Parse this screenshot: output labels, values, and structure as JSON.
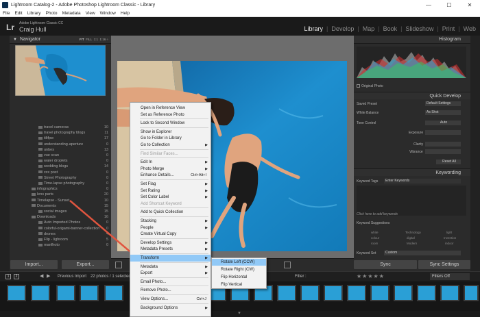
{
  "window": {
    "title": "Lightroom Catalog-2 - Adobe Photoshop Lightroom Classic - Library",
    "controls": [
      "—",
      "☐",
      "✕"
    ]
  },
  "menubar": [
    "File",
    "Edit",
    "Library",
    "Photo",
    "Metadata",
    "View",
    "Window",
    "Help"
  ],
  "identity": {
    "logo": "Lr",
    "product": "Adobe Lightroom Classic CC",
    "user": "Craig Hull"
  },
  "modules": [
    "Library",
    "Develop",
    "Map",
    "Book",
    "Slideshow",
    "Print",
    "Web"
  ],
  "active_module": "Library",
  "navigator": {
    "title": "Navigator",
    "zoom_options": [
      "FIT",
      "FILL",
      "1:1",
      "1:16 ÷"
    ]
  },
  "folders": [
    {
      "label": "travel cameras",
      "count": "10",
      "indent": 1
    },
    {
      "label": "travel photography blogs",
      "count": "11",
      "indent": 1
    },
    {
      "label": "tiltfpw",
      "count": "17",
      "indent": 1
    },
    {
      "label": "understanding-aperture",
      "count": "0",
      "indent": 1
    },
    {
      "label": "unbes",
      "count": "13",
      "indent": 1
    },
    {
      "label": "vue scan",
      "count": "0",
      "indent": 1
    },
    {
      "label": "water droplets",
      "count": "0",
      "indent": 1
    },
    {
      "label": "wedding blogs",
      "count": "14",
      "indent": 1
    },
    {
      "label": "xxx post",
      "count": "0",
      "indent": 1
    },
    {
      "label": "Street Photography",
      "count": "0",
      "indent": 1
    },
    {
      "label": "Time-lapse photography",
      "count": "0",
      "indent": 1
    },
    {
      "label": "infographics",
      "count": "0",
      "indent": 0
    },
    {
      "label": "lens parts",
      "count": "20",
      "indent": 0
    },
    {
      "label": "Timelapse - Sunset",
      "count": "10",
      "indent": 0
    },
    {
      "label": "Documents",
      "count": "15",
      "indent": 0
    },
    {
      "label": "social images",
      "count": "15",
      "indent": 1
    },
    {
      "label": "Downloads",
      "count": "16",
      "indent": 0
    },
    {
      "label": "Auto Imported Photos",
      "count": "0",
      "indent": 1
    },
    {
      "label": "colorful-origami-banner-collection",
      "count": "0",
      "indent": 1
    },
    {
      "label": "drones",
      "count": "4",
      "indent": 1
    },
    {
      "label": "Flip - lighroom",
      "count": "5",
      "indent": 1
    },
    {
      "label": "manfhoto",
      "count": "0",
      "indent": 1
    }
  ],
  "left_buttons": {
    "import": "Import...",
    "export": "Export..."
  },
  "histogram": {
    "title": "Histogram",
    "original_photo": "Original Photo"
  },
  "quick_develop": {
    "title": "Quick Develop",
    "saved_preset_label": "Saved Preset",
    "saved_preset_value": "Default Settings",
    "white_balance_label": "White Balance",
    "white_balance_value": "As Shot",
    "tone_control_label": "Tone Control",
    "tone_auto": "Auto",
    "exposure": "Exposure",
    "clarity": "Clarity",
    "vibrance": "Vibrance",
    "reset": "Reset All"
  },
  "keywording": {
    "title": "Keywording",
    "tags_label": "Keyword Tags",
    "tags_value": "Enter Keywords",
    "add_hint": "Click here to add keywords",
    "suggestions_label": "Keyword Suggestions",
    "suggestions": [
      "white",
      "Technology",
      "light",
      "colour",
      "digital",
      "Invention",
      "room",
      "Modern",
      "indoor"
    ],
    "keyword_set_label": "Keyword Set",
    "keyword_set_value": "Custom"
  },
  "right_buttons": {
    "sync": "Sync",
    "sync_settings": "Sync Settings"
  },
  "filmstrip_bar": {
    "pages": [
      "1",
      "2"
    ],
    "source": "Previous Import",
    "count": "22 photos / 1 selected",
    "filter_label": "Filter :",
    "filter_value": "Filters Off"
  },
  "context_menu": [
    {
      "label": "Open in Reference View",
      "type": "item"
    },
    {
      "label": "Set as Reference Photo",
      "type": "item"
    },
    {
      "type": "sep"
    },
    {
      "label": "Lock to Second Window",
      "type": "item"
    },
    {
      "type": "sep"
    },
    {
      "label": "Show in Explorer",
      "type": "item"
    },
    {
      "label": "Go to Folder in Library",
      "type": "item"
    },
    {
      "label": "Go to Collection",
      "type": "item",
      "submenu": true
    },
    {
      "type": "sep"
    },
    {
      "label": "Find Similar Faces...",
      "type": "item",
      "disabled": true
    },
    {
      "type": "sep"
    },
    {
      "label": "Edit In",
      "type": "item",
      "submenu": true
    },
    {
      "label": "Photo Merge",
      "type": "item",
      "submenu": true
    },
    {
      "label": "Enhance Details...",
      "type": "item",
      "shortcut": "Ctrl+Alt+I"
    },
    {
      "type": "sep"
    },
    {
      "label": "Set Flag",
      "type": "item",
      "submenu": true
    },
    {
      "label": "Set Rating",
      "type": "item",
      "submenu": true
    },
    {
      "label": "Set Color Label",
      "type": "item",
      "submenu": true
    },
    {
      "label": "Add Shortcut Keyword",
      "type": "item",
      "disabled": true
    },
    {
      "type": "sep"
    },
    {
      "label": "Add to Quick Collection",
      "type": "item"
    },
    {
      "type": "sep"
    },
    {
      "label": "Stacking",
      "type": "item",
      "submenu": true
    },
    {
      "label": "People",
      "type": "item",
      "submenu": true
    },
    {
      "label": "Create Virtual Copy",
      "type": "item"
    },
    {
      "type": "sep"
    },
    {
      "label": "Develop Settings",
      "type": "item",
      "submenu": true
    },
    {
      "label": "Metadata Presets",
      "type": "item",
      "submenu": true
    },
    {
      "type": "sep"
    },
    {
      "label": "Transform",
      "type": "item",
      "submenu": true,
      "highlight": true
    },
    {
      "type": "sep"
    },
    {
      "label": "Metadata",
      "type": "item",
      "submenu": true
    },
    {
      "label": "Export",
      "type": "item",
      "submenu": true
    },
    {
      "type": "sep"
    },
    {
      "label": "Email Photo...",
      "type": "item"
    },
    {
      "type": "sep"
    },
    {
      "label": "Remove Photo...",
      "type": "item"
    },
    {
      "type": "sep"
    },
    {
      "label": "View Options...",
      "type": "item",
      "shortcut": "Ctrl+J"
    },
    {
      "type": "sep"
    },
    {
      "label": "Background Options",
      "type": "item",
      "submenu": true
    }
  ],
  "transform_submenu": [
    "Rotate Left (CCW)",
    "Rotate Right (CW)",
    "Flip Horizontal",
    "Flip Vertical"
  ],
  "colors": {
    "menu_highlight": "#91c9f7",
    "annotation_arrow": "#e0553f",
    "pool_water": "#1e8fcf"
  }
}
